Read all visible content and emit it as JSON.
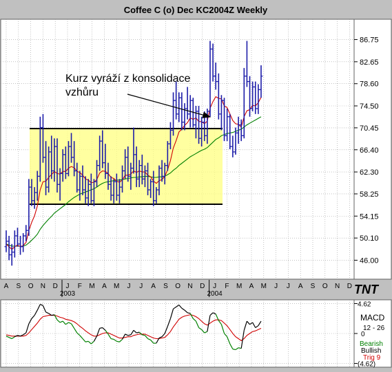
{
  "window": {
    "title": "Coffee C (o) Dec KC2004Z Weekly"
  },
  "annotation": {
    "line1": "Kurz vyráží z konsolidace",
    "line2": "vzhůru"
  },
  "branding": {
    "logo": "TNT"
  },
  "colors": {
    "background": "#c0c0c0",
    "panel": "#ffffff",
    "grid": "#9a9a9a",
    "bars": "#1c1ca8",
    "ma_fast": "#d00000",
    "ma_slow": "#008000",
    "consolidation_box": "#ffff80",
    "macd": "#000000",
    "signal": "#d00000",
    "bearish": "#008000",
    "trig": "#d00000"
  },
  "chart_data": [
    {
      "type": "ohlc",
      "title": "Coffee C (o) Dec KC2004Z Weekly",
      "x_months": [
        "A",
        "S",
        "O",
        "N",
        "D",
        "J",
        "F",
        "M",
        "A",
        "M",
        "J",
        "J",
        "A",
        "S",
        "O",
        "N",
        "D",
        "J",
        "F",
        "M",
        "A",
        "M",
        "J",
        "J",
        "A",
        "S",
        "O",
        "N",
        "D"
      ],
      "year_labels": [
        {
          "label": "2003",
          "month_index": 5
        },
        {
          "label": "2004",
          "month_index": 17
        }
      ],
      "yticks": [
        46.0,
        50.1,
        54.15,
        58.25,
        62.3,
        66.4,
        70.45,
        74.5,
        78.6,
        82.65,
        86.75
      ],
      "ylim": [
        42.5,
        90.5
      ],
      "grid": true,
      "bars_per_month": 4.33,
      "ohlc": [
        [
          48.5,
          51.5,
          47.5,
          49.5
        ],
        [
          49.5,
          50.5,
          46.0,
          47.0
        ],
        [
          47.0,
          49.0,
          45.0,
          47.5
        ],
        [
          47.5,
          51.5,
          46.5,
          50.5
        ],
        [
          50.5,
          52.0,
          48.5,
          49.0
        ],
        [
          49.0,
          50.5,
          47.0,
          48.5
        ],
        [
          48.5,
          51.0,
          47.5,
          50.5
        ],
        [
          50.5,
          52.5,
          49.5,
          51.5
        ],
        [
          51.5,
          61.0,
          50.5,
          59.5
        ],
        [
          59.5,
          61.0,
          56.0,
          57.0
        ],
        [
          57.0,
          59.5,
          55.5,
          58.5
        ],
        [
          58.5,
          62.5,
          57.0,
          61.5
        ],
        [
          61.5,
          72.5,
          60.5,
          70.5
        ],
        [
          70.5,
          73.0,
          64.0,
          65.0
        ],
        [
          65.0,
          68.0,
          58.0,
          59.5
        ],
        [
          59.5,
          67.0,
          58.5,
          66.0
        ],
        [
          66.0,
          69.0,
          61.0,
          62.5
        ],
        [
          62.5,
          68.5,
          60.5,
          67.0
        ],
        [
          67.0,
          68.5,
          58.5,
          60.0
        ],
        [
          60.0,
          63.0,
          57.0,
          62.0
        ],
        [
          62.0,
          66.5,
          60.5,
          65.5
        ],
        [
          65.5,
          67.0,
          61.0,
          62.0
        ],
        [
          62.0,
          68.0,
          61.5,
          67.0
        ],
        [
          67.0,
          69.5,
          64.0,
          65.0
        ],
        [
          65.0,
          68.0,
          61.5,
          62.5
        ],
        [
          62.5,
          64.0,
          58.5,
          59.0
        ],
        [
          59.0,
          62.5,
          57.0,
          61.5
        ],
        [
          61.5,
          63.5,
          58.0,
          59.0
        ],
        [
          59.0,
          61.5,
          56.5,
          57.5
        ],
        [
          57.5,
          61.0,
          56.0,
          60.0
        ],
        [
          60.0,
          62.0,
          56.5,
          57.0
        ],
        [
          57.0,
          61.0,
          56.0,
          60.5
        ],
        [
          60.5,
          64.5,
          59.5,
          63.5
        ],
        [
          63.5,
          69.0,
          62.5,
          68.0
        ],
        [
          68.0,
          70.0,
          63.0,
          64.0
        ],
        [
          64.0,
          67.5,
          61.0,
          62.0
        ],
        [
          62.0,
          64.0,
          59.0,
          60.0
        ],
        [
          60.0,
          61.5,
          57.0,
          58.0
        ],
        [
          58.0,
          61.0,
          56.5,
          60.5
        ],
        [
          60.5,
          62.0,
          57.0,
          58.0
        ],
        [
          58.0,
          61.0,
          56.5,
          59.5
        ],
        [
          59.5,
          63.5,
          58.5,
          62.5
        ],
        [
          62.5,
          66.5,
          61.0,
          65.0
        ],
        [
          65.0,
          67.0,
          60.5,
          61.5
        ],
        [
          61.5,
          64.0,
          59.0,
          63.0
        ],
        [
          63.0,
          70.5,
          62.0,
          65.5
        ],
        [
          65.5,
          67.0,
          59.5,
          61.0
        ],
        [
          61.0,
          64.5,
          59.5,
          63.5
        ],
        [
          63.5,
          65.5,
          60.0,
          61.0
        ],
        [
          61.0,
          63.5,
          59.5,
          62.5
        ],
        [
          62.5,
          64.0,
          58.0,
          59.0
        ],
        [
          59.0,
          61.0,
          57.5,
          60.5
        ],
        [
          60.5,
          62.5,
          56.0,
          57.0
        ],
        [
          57.0,
          59.5,
          56.5,
          59.0
        ],
        [
          59.0,
          63.5,
          58.0,
          63.0
        ],
        [
          63.0,
          64.5,
          60.5,
          61.5
        ],
        [
          61.5,
          64.0,
          60.0,
          63.5
        ],
        [
          63.5,
          68.0,
          62.5,
          67.5
        ],
        [
          67.5,
          71.5,
          66.5,
          70.0
        ],
        [
          70.0,
          77.0,
          69.0,
          75.5
        ],
        [
          75.5,
          79.0,
          72.0,
          73.0
        ],
        [
          73.0,
          77.0,
          71.5,
          76.0
        ],
        [
          76.0,
          77.0,
          70.0,
          71.5
        ],
        [
          71.5,
          75.0,
          70.0,
          74.0
        ],
        [
          74.0,
          78.0,
          72.0,
          73.0
        ],
        [
          73.0,
          76.5,
          70.5,
          75.5
        ],
        [
          75.5,
          76.0,
          70.5,
          71.0
        ],
        [
          71.0,
          74.5,
          68.5,
          73.5
        ],
        [
          73.5,
          74.5,
          67.5,
          68.5
        ],
        [
          68.5,
          72.5,
          67.0,
          71.5
        ],
        [
          71.5,
          73.5,
          68.0,
          69.0
        ],
        [
          69.0,
          74.0,
          67.5,
          73.5
        ],
        [
          73.5,
          86.5,
          72.5,
          85.0
        ],
        [
          85.0,
          86.0,
          79.0,
          80.0
        ],
        [
          80.0,
          82.5,
          77.5,
          79.0
        ],
        [
          79.0,
          80.5,
          72.0,
          73.0
        ],
        [
          73.0,
          76.5,
          70.0,
          75.5
        ],
        [
          75.5,
          76.0,
          68.0,
          69.0
        ],
        [
          69.0,
          74.0,
          68.0,
          72.5
        ],
        [
          72.5,
          73.0,
          66.5,
          67.0
        ],
        [
          67.0,
          69.0,
          65.0,
          66.0
        ],
        [
          66.0,
          70.5,
          65.5,
          69.5
        ],
        [
          69.5,
          72.5,
          67.5,
          71.0
        ],
        [
          71.0,
          72.0,
          68.0,
          69.0
        ],
        [
          69.0,
          81.5,
          68.5,
          80.0
        ],
        [
          80.0,
          86.5,
          78.0,
          79.0
        ],
        [
          79.0,
          80.0,
          72.5,
          74.0
        ],
        [
          74.0,
          79.0,
          73.5,
          78.0
        ],
        [
          78.0,
          79.0,
          73.0,
          74.0
        ],
        [
          74.0,
          78.5,
          73.0,
          77.5
        ],
        [
          77.5,
          82.0,
          76.0,
          80.0
        ]
      ],
      "series": [
        {
          "kind": "ma_fast",
          "values": [
            49.0,
            48.5,
            48.0,
            48.5,
            48.8,
            48.5,
            48.7,
            49.3,
            51.5,
            53.0,
            54.2,
            56.0,
            59.0,
            60.5,
            60.6,
            61.3,
            61.8,
            62.4,
            62.0,
            61.9,
            62.4,
            62.4,
            63.0,
            63.3,
            63.1,
            62.4,
            62.2,
            61.7,
            61.0,
            60.8,
            60.3,
            60.4,
            60.9,
            62.1,
            62.5,
            62.4,
            62.0,
            61.3,
            61.1,
            60.6,
            60.4,
            60.8,
            61.7,
            61.7,
            61.9,
            62.5,
            62.2,
            62.5,
            62.3,
            62.3,
            61.7,
            61.4,
            60.6,
            60.2,
            60.7,
            60.9,
            61.5,
            62.7,
            64.4,
            66.7,
            68.1,
            69.7,
            70.2,
            70.9,
            71.4,
            72.3,
            72.0,
            72.3,
            71.6,
            71.6,
            71.2,
            71.7,
            74.1,
            75.3,
            76.2,
            75.9,
            75.8,
            74.5,
            74.2,
            73.0,
            71.8,
            71.2,
            71.1,
            70.6,
            72.5,
            73.6,
            73.8,
            74.6,
            74.5,
            75.1,
            76.1
          ]
        },
        {
          "kind": "ma_slow",
          "values": [
            49.0,
            48.8,
            48.6,
            48.6,
            48.6,
            48.6,
            48.6,
            48.8,
            49.2,
            49.7,
            50.2,
            50.8,
            51.7,
            52.4,
            53.0,
            53.6,
            54.1,
            54.7,
            55.1,
            55.5,
            55.9,
            56.3,
            56.8,
            57.2,
            57.6,
            57.9,
            58.2,
            58.4,
            58.6,
            58.8,
            59.0,
            59.2,
            59.5,
            59.9,
            60.2,
            60.4,
            60.5,
            60.6,
            60.7,
            60.8,
            60.8,
            60.9,
            61.0,
            61.1,
            61.2,
            61.3,
            61.3,
            61.4,
            61.4,
            61.5,
            61.5,
            61.4,
            61.3,
            61.3,
            61.4,
            61.4,
            61.5,
            61.8,
            62.1,
            62.6,
            63.0,
            63.5,
            63.9,
            64.3,
            64.7,
            65.1,
            65.4,
            65.7,
            66.0,
            66.3,
            66.5,
            66.8,
            67.3,
            67.8,
            68.3,
            68.6,
            69.0,
            69.2,
            69.4,
            69.5,
            69.6,
            69.8,
            70.0,
            70.2,
            70.6,
            71.0,
            71.3,
            71.6,
            71.9,
            72.2,
            72.5
          ]
        }
      ]
    },
    {
      "type": "line",
      "indicator": "MACD",
      "params": "12 - 26",
      "legend": [
        "Bearish",
        "Bullish",
        "Trig 9"
      ],
      "yticks": [
        {
          "label": "4.62",
          "value": 4.62
        },
        {
          "label": "0",
          "value": 0
        },
        {
          "label": "(4.62)",
          "value": -4.62
        }
      ],
      "ylim": [
        -5.2,
        5.2
      ],
      "series": [
        {
          "name": "MACD",
          "values": [
            -0.4,
            -0.6,
            -0.8,
            -0.5,
            -0.3,
            -0.4,
            -0.2,
            0.1,
            1.5,
            2.3,
            2.8,
            3.6,
            4.5,
            4.3,
            3.3,
            3.1,
            2.8,
            2.9,
            2.1,
            1.7,
            1.9,
            1.4,
            1.7,
            1.5,
            0.8,
            0.1,
            -0.3,
            -0.8,
            -1.3,
            -1.2,
            -1.6,
            -1.2,
            -0.4,
            0.8,
            0.9,
            0.5,
            -0.1,
            -0.8,
            -0.9,
            -1.2,
            -1.3,
            -0.9,
            -0.1,
            -0.3,
            -0.2,
            0.5,
            0.1,
            0.2,
            -0.2,
            -0.3,
            -0.8,
            -1.0,
            -1.5,
            -1.5,
            -0.7,
            -0.5,
            0.0,
            1.1,
            2.3,
            3.8,
            4.1,
            4.4,
            3.9,
            3.6,
            3.2,
            3.1,
            2.3,
            1.9,
            0.9,
            0.6,
            0.1,
            0.3,
            2.8,
            3.2,
            3.0,
            2.0,
            1.4,
            0.0,
            -0.5,
            -1.6,
            -2.4,
            -2.5,
            -2.2,
            -2.3,
            0.5,
            1.9,
            1.4,
            1.7,
            0.9,
            1.2,
            1.9
          ]
        },
        {
          "name": "Trig 9",
          "values": [
            -0.2,
            -0.3,
            -0.4,
            -0.4,
            -0.4,
            -0.4,
            -0.4,
            -0.3,
            0.1,
            0.6,
            1.1,
            1.6,
            2.2,
            2.6,
            2.7,
            2.8,
            2.8,
            2.8,
            2.7,
            2.5,
            2.4,
            2.2,
            2.1,
            2.0,
            1.8,
            1.5,
            1.1,
            0.8,
            0.4,
            0.1,
            -0.2,
            -0.4,
            -0.4,
            -0.2,
            0.0,
            0.1,
            0.1,
            -0.1,
            -0.3,
            -0.5,
            -0.7,
            -0.7,
            -0.6,
            -0.5,
            -0.5,
            -0.3,
            -0.2,
            -0.1,
            -0.1,
            -0.1,
            -0.3,
            -0.5,
            -0.7,
            -0.8,
            -0.8,
            -0.7,
            -0.6,
            -0.2,
            0.3,
            1.0,
            1.6,
            2.2,
            2.5,
            2.7,
            2.8,
            2.9,
            2.8,
            2.6,
            2.3,
            1.9,
            1.5,
            1.3,
            1.6,
            1.9,
            2.1,
            2.1,
            2.0,
            1.6,
            1.2,
            0.6,
            0.0,
            -0.5,
            -0.8,
            -1.1,
            -0.8,
            -0.3,
            0.0,
            0.3,
            0.4,
            0.6,
            0.8
          ]
        }
      ]
    }
  ]
}
